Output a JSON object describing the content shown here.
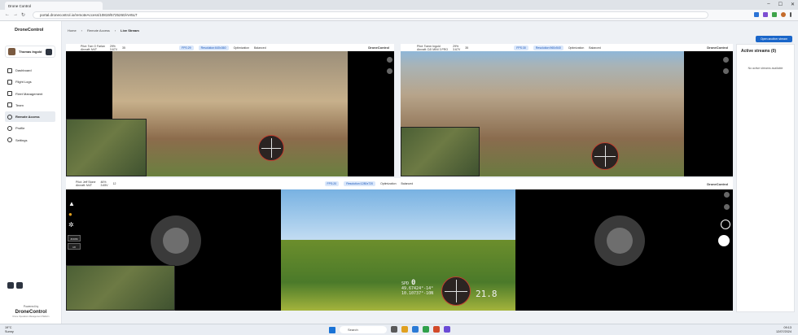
{
  "browser": {
    "tab_title": "Drone Control",
    "url": "portal.dronecontrol.io/remoteAccess/10819/5725260/AH5LT"
  },
  "sidebar": {
    "logo": "DroneControl",
    "user_name": "Thomas Ingold",
    "items": [
      {
        "label": "Dashboard"
      },
      {
        "label": "Flight Logs"
      },
      {
        "label": "Fleet Management"
      },
      {
        "label": "Team"
      },
      {
        "label": "Remote Access"
      },
      {
        "label": "Profile"
      },
      {
        "label": "Settings"
      }
    ],
    "powered_by": "Powered by",
    "footer_logo": "DroneControl",
    "tagline": "Drone Operations Management Platform"
  },
  "breadcrumb": {
    "home": "Home",
    "remote_access": "Remote Access",
    "current": "Live Stream"
  },
  "open_stream_button": "Open another stream",
  "active_streams": {
    "title": "Active streams (0)",
    "empty": "No active streams available"
  },
  "streams": {
    "top_left": {
      "pilot": "Pilot: Tom O Farlan",
      "aircraft": "Aircraft: M4T",
      "battery": "29%",
      "voltage": "3.67V",
      "signal": "35",
      "fps": "FPS:29",
      "resolution": "Resolution:640x360",
      "optimization": "Optimization",
      "mode": "Balanced",
      "brand": "DroneControl"
    },
    "top_right": {
      "pilot": "Pilot: Tomm Ingold",
      "aircraft": "Aircraft: DJI MINI 3 PRO",
      "battery": "29%",
      "voltage": "3.67V",
      "signal": "35",
      "fps": "FPS:30",
      "resolution": "Resolution:960x540",
      "optimization": "Optimization",
      "mode": "Balanced",
      "brand": "DroneControl"
    },
    "bottom": {
      "pilot": "Pilot: Jeff Stone",
      "aircraft": "Aircraft: M4T",
      "battery": "46%",
      "voltage": "3.65V",
      "signal": "12",
      "fps": "FPS:20",
      "resolution": "Resolution:1280x720",
      "optimization": "Optimization",
      "mode": "Balanced",
      "brand": "DroneControl",
      "zoom_label": "ZOOM",
      "zoom_value": "1X",
      "speed_label": "SPD",
      "speed_value": "0",
      "coord_1": "49.67424°-14°",
      "coord_2": "10.10737°-10N",
      "altitude": "21.8"
    }
  },
  "taskbar": {
    "temperature": "19°C",
    "weather": "Sunny",
    "search": "Search",
    "time": "09:13",
    "date": "12/07/2024"
  }
}
